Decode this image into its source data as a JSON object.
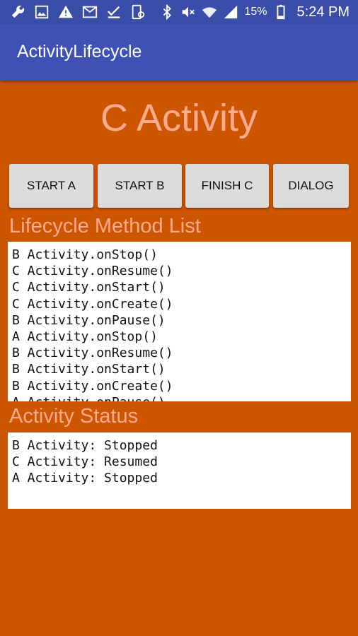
{
  "status_bar": {
    "icons_left": [
      "wrench-icon",
      "image-icon",
      "warning-icon",
      "mail-icon",
      "check-icon",
      "device-icon"
    ],
    "icons_right": [
      "bluetooth-icon",
      "mute-icon",
      "wifi-icon",
      "signal-icon",
      "battery-icon"
    ],
    "battery": "15%",
    "time": "5:24 PM"
  },
  "app_bar": {
    "title": "ActivityLifecycle",
    "color": "#3F51B5"
  },
  "activity": {
    "title": "C Activity",
    "background": "#CC5500",
    "accent": "#FFAB91"
  },
  "buttons": {
    "start_a": "START A",
    "start_b": "START B",
    "finish_c": "FINISH C",
    "dialog": "DIALOG"
  },
  "lifecycle": {
    "label": "Lifecycle Method List",
    "lines": [
      "B Activity.onStop()",
      "C Activity.onResume()",
      "C Activity.onStart()",
      "C Activity.onCreate()",
      "B Activity.onPause()",
      "A Activity.onStop()",
      "B Activity.onResume()",
      "B Activity.onStart()",
      "B Activity.onCreate()",
      "A Activity.onPause()"
    ]
  },
  "status": {
    "label": "Activity Status",
    "lines": [
      "B Activity: Stopped",
      "C Activity: Resumed",
      "A Activity: Stopped"
    ]
  }
}
